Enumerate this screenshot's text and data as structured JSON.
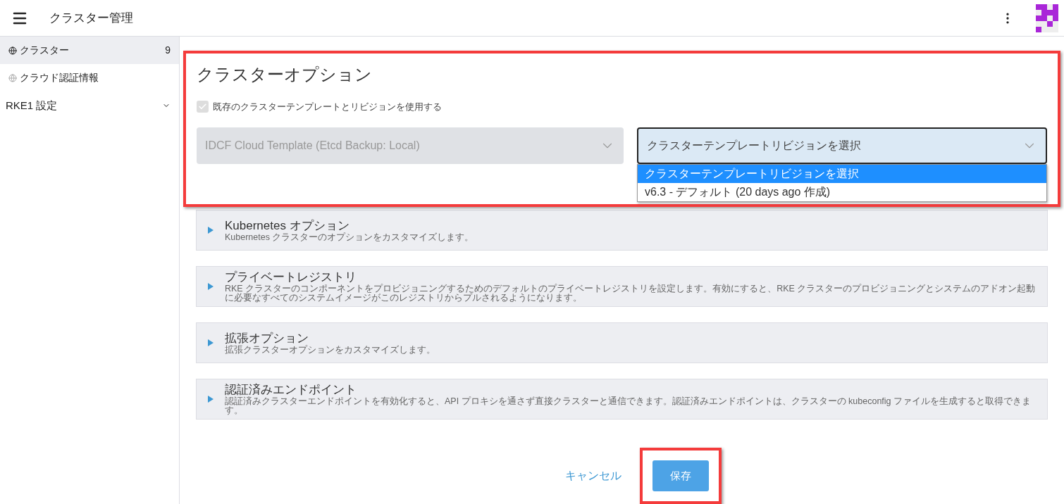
{
  "header": {
    "title": "クラスター管理"
  },
  "sidebar": {
    "items": [
      {
        "label": "クラスター",
        "count": "9",
        "selected": true
      },
      {
        "label": "クラウド認証情報",
        "selected": false
      }
    ],
    "group": {
      "label": "RKE1 設定",
      "expanded": false
    }
  },
  "cluster_options": {
    "title": "クラスターオプション",
    "use_template": {
      "label": "既存のクラスターテンプレートとリビジョンを使用する",
      "checked": true,
      "disabled": true
    },
    "template_select": {
      "value": "IDCF Cloud Template (Etcd Backup: Local)",
      "disabled": true
    },
    "revision_select": {
      "value": "クラスターテンプレートリビジョンを選択",
      "expanded": true,
      "options": [
        {
          "label": "クラスターテンプレートリビジョンを選択",
          "selected": true
        },
        {
          "label": "v6.3 - デフォルト (20 days ago 作成)",
          "selected": false
        }
      ]
    }
  },
  "sections": [
    {
      "title": "Kubernetes オプション",
      "description": "Kubernetes クラスターのオプションをカスタマイズします。",
      "expanded": false
    },
    {
      "title": "プライベートレジストリ",
      "description": "RKE クラスターのコンポーネントをプロビジョニングするためのデフォルトのプライベートレジストリを設定します。有効にすると、RKE クラスターのプロビジョニングとシステムのアドオン起動に必要なすべてのシステムイメージがこのレジストリからプルされるようになります。",
      "expanded": false
    },
    {
      "title": "拡張オプション",
      "description": "拡張クラスターオプションをカスタマイズします。",
      "expanded": false
    },
    {
      "title": "認証済みエンドポイント",
      "description": "認証済みクラスターエンドポイントを有効化すると、API プロキシを通さず直接クラスターと通信できます。認証済みエンドポイントは、クラスターの kubeconfig ファイルを生成すると取得できます。",
      "expanded": false
    }
  ],
  "actions": {
    "cancel": "キャンセル",
    "save": "保存"
  }
}
